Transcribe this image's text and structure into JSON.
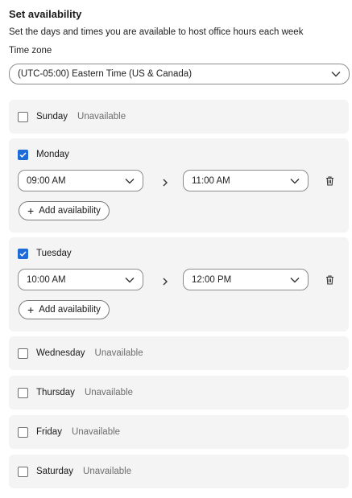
{
  "header": {
    "title": "Set availability",
    "subtitle": "Set the days and times you are available to host office hours each week",
    "timezone_label": "Time zone",
    "timezone_value": "(UTC-05:00) Eastern Time (US & Canada)"
  },
  "labels": {
    "unavailable": "Unavailable",
    "add_availability": "Add availability"
  },
  "days": {
    "sunday": {
      "name": "Sunday",
      "checked": false
    },
    "monday": {
      "name": "Monday",
      "checked": true,
      "start": "09:00 AM",
      "end": "11:00 AM"
    },
    "tuesday": {
      "name": "Tuesday",
      "checked": true,
      "start": "10:00 AM",
      "end": "12:00 PM"
    },
    "wednesday": {
      "name": "Wednesday",
      "checked": false
    },
    "thursday": {
      "name": "Thursday",
      "checked": false
    },
    "friday": {
      "name": "Friday",
      "checked": false
    },
    "saturday": {
      "name": "Saturday",
      "checked": false
    }
  },
  "colors": {
    "accent": "#1f6ad9",
    "card": "#f4f4f4",
    "muted": "#6d6d6d"
  },
  "icons": [
    "chevron-down-icon",
    "checkmark-icon",
    "chevron-right-icon",
    "trash-icon",
    "plus-icon"
  ]
}
